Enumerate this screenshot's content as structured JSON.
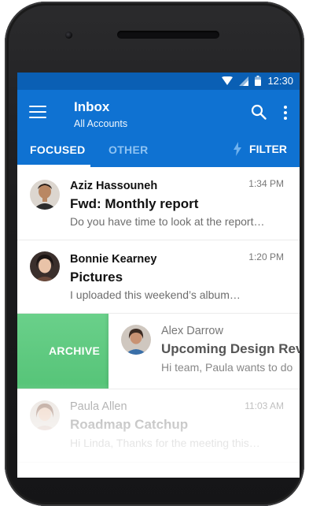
{
  "status_bar": {
    "time": "12:30",
    "icons": [
      "wifi-icon",
      "signal-icon",
      "battery-icon"
    ]
  },
  "header": {
    "title": "Inbox",
    "subtitle": "All Accounts",
    "icons": [
      "menu-icon",
      "search-icon",
      "more-icon"
    ]
  },
  "tabs": [
    {
      "label": "FOCUSED",
      "active": true
    },
    {
      "label": "OTHER",
      "active": false
    }
  ],
  "filter": {
    "label": "FILTER",
    "icon": "lightning-icon"
  },
  "swipe_action": {
    "label": "ARCHIVE",
    "color": "#5ac67c"
  },
  "messages": [
    {
      "sender": "Aziz Hassouneh",
      "subject": "Fwd: Monthly report",
      "preview": "Do you have time to look at the report…",
      "time": "1:34 PM"
    },
    {
      "sender": "Bonnie Kearney",
      "subject": "Pictures",
      "preview": "I uploaded this weekend’s album…",
      "time": "1:20 PM"
    },
    {
      "sender": "Alex Darrow",
      "subject": "Upcoming Design Review",
      "preview": "Hi team, Paula wants to do",
      "time": ""
    },
    {
      "sender": "Paula Allen",
      "subject": "Roadmap Catchup",
      "preview": "Hi Linda, Thanks for the meeting this…",
      "time": "11:03 AM"
    }
  ],
  "colors": {
    "status_bar": "#0a5fb4",
    "app_bar": "#0f72d2",
    "tab_inactive": "#8fc3f2",
    "archive": "#5ac67c"
  }
}
